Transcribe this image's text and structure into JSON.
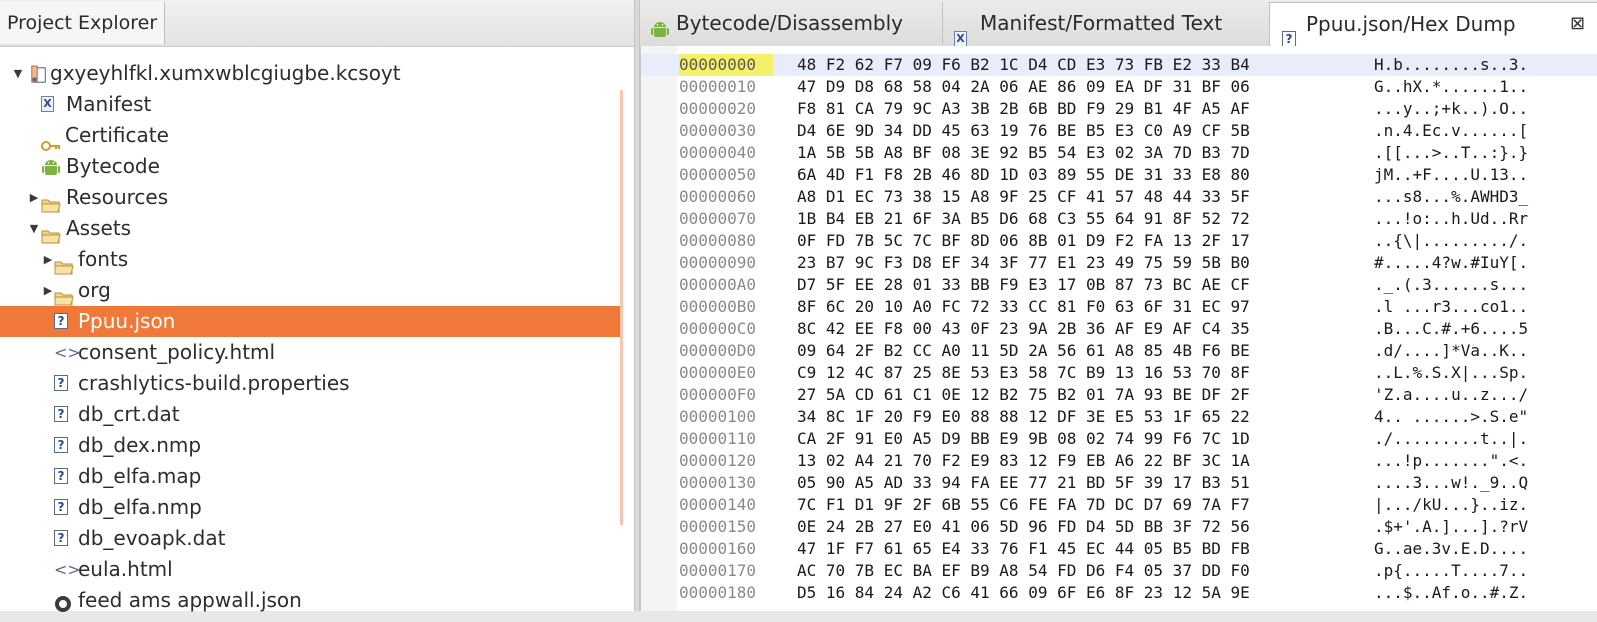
{
  "explorer": {
    "title": "Project Explorer",
    "tree": [
      {
        "label": "gxyeyhlfkl.xumxwblcgiugbe.kcsoyt",
        "icon": "apk-project-icon",
        "twisty": "expanded",
        "indent": 0
      },
      {
        "label": "Manifest",
        "icon": "manifest-file-icon",
        "twisty": "none",
        "indent": 1
      },
      {
        "label": "Certificate",
        "icon": "key-icon",
        "twisty": "none",
        "indent": 1
      },
      {
        "label": "Bytecode",
        "icon": "android-icon",
        "twisty": "none",
        "indent": 1
      },
      {
        "label": "Resources",
        "icon": "folder-icon",
        "twisty": "collapsed",
        "indent": 1
      },
      {
        "label": "Assets",
        "icon": "folder-icon",
        "twisty": "expanded",
        "indent": 1
      },
      {
        "label": "fonts",
        "icon": "folder-icon",
        "twisty": "collapsed",
        "indent": 2
      },
      {
        "label": "org",
        "icon": "folder-icon",
        "twisty": "collapsed",
        "indent": 2
      },
      {
        "label": "Ppuu.json",
        "icon": "unknown-file-icon",
        "twisty": "none",
        "indent": 2,
        "selected": true
      },
      {
        "label": "consent_policy.html",
        "icon": "html-file-icon",
        "twisty": "none",
        "indent": 2
      },
      {
        "label": "crashlytics-build.properties",
        "icon": "unknown-file-icon",
        "twisty": "none",
        "indent": 2
      },
      {
        "label": "db_crt.dat",
        "icon": "unknown-file-icon",
        "twisty": "none",
        "indent": 2
      },
      {
        "label": "db_dex.nmp",
        "icon": "unknown-file-icon",
        "twisty": "none",
        "indent": 2
      },
      {
        "label": "db_elfa.map",
        "icon": "unknown-file-icon",
        "twisty": "none",
        "indent": 2
      },
      {
        "label": "db_elfa.nmp",
        "icon": "unknown-file-icon",
        "twisty": "none",
        "indent": 2
      },
      {
        "label": "db_evoapk.dat",
        "icon": "unknown-file-icon",
        "twisty": "none",
        "indent": 2
      },
      {
        "label": "eula.html",
        "icon": "html-file-icon",
        "twisty": "none",
        "indent": 2
      },
      {
        "label": "feed ams appwall.json",
        "icon": "globe-file-icon",
        "twisty": "none",
        "indent": 2
      }
    ]
  },
  "editor": {
    "tabs": [
      {
        "label": "Bytecode/Disassembly",
        "icon": "android-icon",
        "active": false
      },
      {
        "label": "Manifest/Formatted Text",
        "icon": "manifest-file-icon",
        "active": false
      },
      {
        "label": "Ppuu.json/Hex Dump",
        "icon": "unknown-file-icon",
        "active": true
      }
    ],
    "close_glyph": "⊠",
    "hex_rows": [
      {
        "offset": "00000000",
        "bytes": "48 F2 62 F7 09 F6 B2 1C D4 CD E3 73 FB E2 33 B4",
        "ascii": "H.b........s..3."
      },
      {
        "offset": "00000010",
        "bytes": "47 D9 D8 68 58 04 2A 06 AE 86 09 EA DF 31 BF 06",
        "ascii": "G..hX.*......1.."
      },
      {
        "offset": "00000020",
        "bytes": "F8 81 CA 79 9C A3 3B 2B 6B BD F9 29 B1 4F A5 AF",
        "ascii": "...y..;+k..).O.."
      },
      {
        "offset": "00000030",
        "bytes": "D4 6E 9D 34 DD 45 63 19 76 BE B5 E3 C0 A9 CF 5B",
        "ascii": ".n.4.Ec.v......["
      },
      {
        "offset": "00000040",
        "bytes": "1A 5B 5B A8 BF 08 3E 92 B5 54 E3 02 3A 7D B3 7D",
        "ascii": ".[[...>..T..:}.}"
      },
      {
        "offset": "00000050",
        "bytes": "6A 4D F1 F8 2B 46 8D 1D 03 89 55 DE 31 33 E8 80",
        "ascii": "jM..+F....U.13.."
      },
      {
        "offset": "00000060",
        "bytes": "A8 D1 EC 73 38 15 A8 9F 25 CF 41 57 48 44 33 5F",
        "ascii": "...s8...%.AWHD3_"
      },
      {
        "offset": "00000070",
        "bytes": "1B B4 EB 21 6F 3A B5 D6 68 C3 55 64 91 8F 52 72",
        "ascii": "...!o:..h.Ud..Rr"
      },
      {
        "offset": "00000080",
        "bytes": "0F FD 7B 5C 7C BF 8D 06 8B 01 D9 F2 FA 13 2F 17",
        "ascii": "..{\\|........./."
      },
      {
        "offset": "00000090",
        "bytes": "23 B7 9C F3 D8 EF 34 3F 77 E1 23 49 75 59 5B B0",
        "ascii": "#.....4?w.#IuY[."
      },
      {
        "offset": "000000A0",
        "bytes": "D7 5F EE 28 01 33 BB F9 E3 17 0B 87 73 BC AE CF",
        "ascii": "._.(.3......s..."
      },
      {
        "offset": "000000B0",
        "bytes": "8F 6C 20 10 A0 FC 72 33 CC 81 F0 63 6F 31 EC 97",
        "ascii": ".l ...r3...co1.."
      },
      {
        "offset": "000000C0",
        "bytes": "8C 42 EE F8 00 43 0F 23 9A 2B 36 AF E9 AF C4 35",
        "ascii": ".B...C.#.+6....5"
      },
      {
        "offset": "000000D0",
        "bytes": "09 64 2F B2 CC A0 11 5D 2A 56 61 A8 85 4B F6 BE",
        "ascii": ".d/....]*Va..K.."
      },
      {
        "offset": "000000E0",
        "bytes": "C9 12 4C 87 25 8E 53 E3 58 7C B9 13 16 53 70 8F",
        "ascii": "..L.%.S.X|...Sp."
      },
      {
        "offset": "000000F0",
        "bytes": "27 5A CD 61 C1 0E 12 B2 75 B2 01 7A 93 BE DF 2F",
        "ascii": "'Z.a....u..z.../"
      },
      {
        "offset": "00000100",
        "bytes": "34 8C 1F 20 F9 E0 88 88 12 DF 3E E5 53 1F 65 22",
        "ascii": "4.. ......>.S.e\""
      },
      {
        "offset": "00000110",
        "bytes": "CA 2F 91 E0 A5 D9 BB E9 9B 08 02 74 99 F6 7C 1D",
        "ascii": "./.........t..|."
      },
      {
        "offset": "00000120",
        "bytes": "13 02 A4 21 70 F2 E9 83 12 F9 EB A6 22 BF 3C 1A",
        "ascii": "...!p.......\".<."
      },
      {
        "offset": "00000130",
        "bytes": "05 90 A5 AD 33 94 FA EE 77 21 BD 5F 39 17 B3 51",
        "ascii": "....3...w!._9..Q"
      },
      {
        "offset": "00000140",
        "bytes": "7C F1 D1 9F 2F 6B 55 C6 FE FA 7D DC D7 69 7A F7",
        "ascii": "|.../kU...}..iz."
      },
      {
        "offset": "00000150",
        "bytes": "0E 24 2B 27 E0 41 06 5D 96 FD D4 5D BB 3F 72 56",
        "ascii": ".$+'.A.]...].?rV"
      },
      {
        "offset": "00000160",
        "bytes": "47 1F F7 61 65 E4 33 76 F1 45 EC 44 05 B5 BD FB",
        "ascii": "G..ae.3v.E.D...."
      },
      {
        "offset": "00000170",
        "bytes": "AC 70 7B EC BA EF B9 A8 54 FD D6 F4 05 37 DD F0",
        "ascii": ".p{.....T....7.."
      },
      {
        "offset": "00000180",
        "bytes": "D5 16 84 24 A2 C6 41 66 09 6F E6 8F 23 12 5A 9E",
        "ascii": "...$..Af.o..#.Z."
      }
    ]
  },
  "colors": {
    "selection": "#f0793a",
    "offset_highlight": "#f4f06a",
    "current_line": "#e8ecfb"
  }
}
